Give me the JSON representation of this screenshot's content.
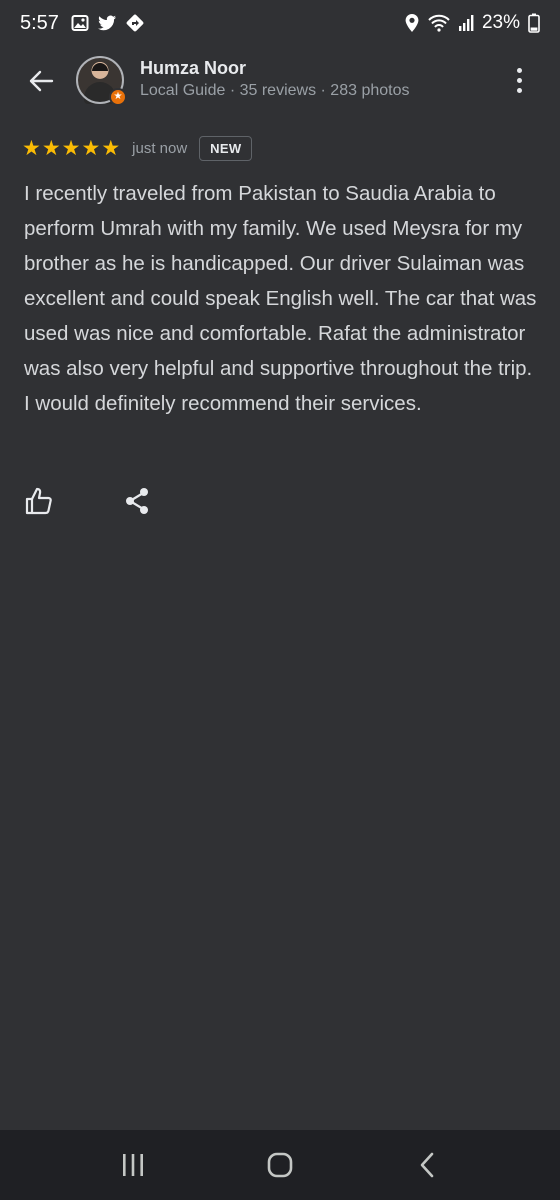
{
  "status_bar": {
    "time": "5:57",
    "battery": "23%",
    "left_icons": [
      "image-icon",
      "twitter-icon",
      "navigation-diamond-icon"
    ],
    "right_icons": [
      "location-icon",
      "wifi-icon",
      "signal-icon",
      "battery-icon"
    ]
  },
  "header": {
    "reviewer_name": "Humza Noor",
    "reviewer_meta": "Local Guide · 35 reviews · 283 photos",
    "badge_icon": "local-guide-star-icon"
  },
  "review": {
    "rating": 5,
    "stars": [
      "★",
      "★",
      "★",
      "★",
      "★"
    ],
    "time_ago": "just now",
    "new_label": "NEW",
    "text": "I recently traveled from Pakistan to Saudia Arabia to perform Umrah with my family. We used Meysra for my brother as he is handicapped. Our driver Sulaiman was excellent and could speak English well. The car that was used was nice and comfortable. Rafat the administrator was also very helpful and supportive throughout the trip. I would definitely recommend their services."
  },
  "actions": [
    "like-icon",
    "share-icon"
  ],
  "nav": [
    "recent-apps-icon",
    "home-icon",
    "back-icon"
  ],
  "colors": {
    "background": "#303134",
    "star": "#fbbc04",
    "badge": "#e8710a",
    "nav_bar": "#1f2024"
  }
}
